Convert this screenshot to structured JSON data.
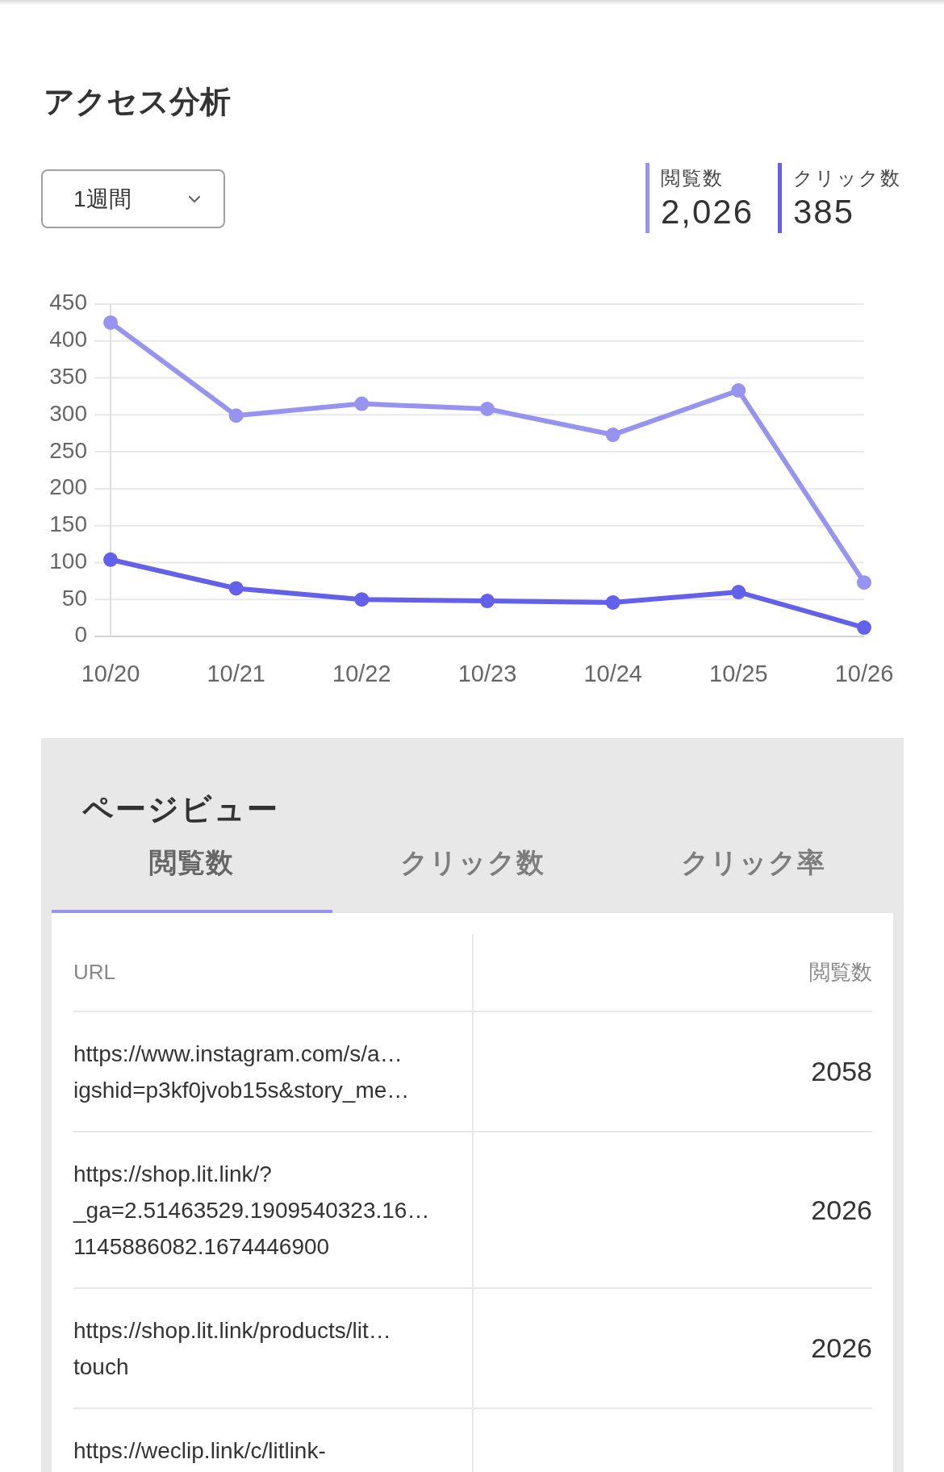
{
  "page_title": "アクセス分析",
  "period_select": {
    "value": "1週間"
  },
  "stats": [
    {
      "label": "閲覧数",
      "value": "2,026",
      "color": "#9794f0"
    },
    {
      "label": "クリック数",
      "value": "385",
      "color": "#6360ea"
    }
  ],
  "chart": {
    "chart_data": {
      "type": "line",
      "grid": true,
      "categories": [
        "10/20",
        "10/21",
        "10/22",
        "10/23",
        "10/24",
        "10/25",
        "10/26"
      ],
      "series": [
        {
          "color": "#9794f0",
          "marker": "circle",
          "values": [
            425,
            299,
            315,
            308,
            273,
            333,
            73
          ]
        },
        {
          "color": "#6360ea",
          "marker": "circle",
          "values": [
            104,
            65,
            50,
            48,
            46,
            60,
            12
          ]
        }
      ],
      "ylim": [
        0,
        450
      ],
      "yticks": [
        0,
        50,
        100,
        150,
        200,
        250,
        300,
        350,
        400,
        450
      ]
    }
  },
  "page_view": {
    "title": "ページビュー",
    "tabs": [
      {
        "label": "閲覧数",
        "selected": true
      },
      {
        "label": "クリック数",
        "selected": false
      },
      {
        "label": "クリック率",
        "selected": false
      }
    ],
    "table": {
      "columns": [
        "URL",
        "閲覧数"
      ],
      "rows": [
        {
          "url": "https://www.instagram.com/s/a…\nigshid=p3kf0jvob15s&story_me…",
          "views": "2058"
        },
        {
          "url": "https://shop.lit.link/?\n_ga=2.51463529.1909540323.16…\n1145886082.1674446900",
          "views": "2026"
        },
        {
          "url": "https://shop.lit.link/products/lit…\ntouch",
          "views": "2026"
        },
        {
          "url": "https://weclip.link/c/litlink-"
        }
      ]
    }
  }
}
